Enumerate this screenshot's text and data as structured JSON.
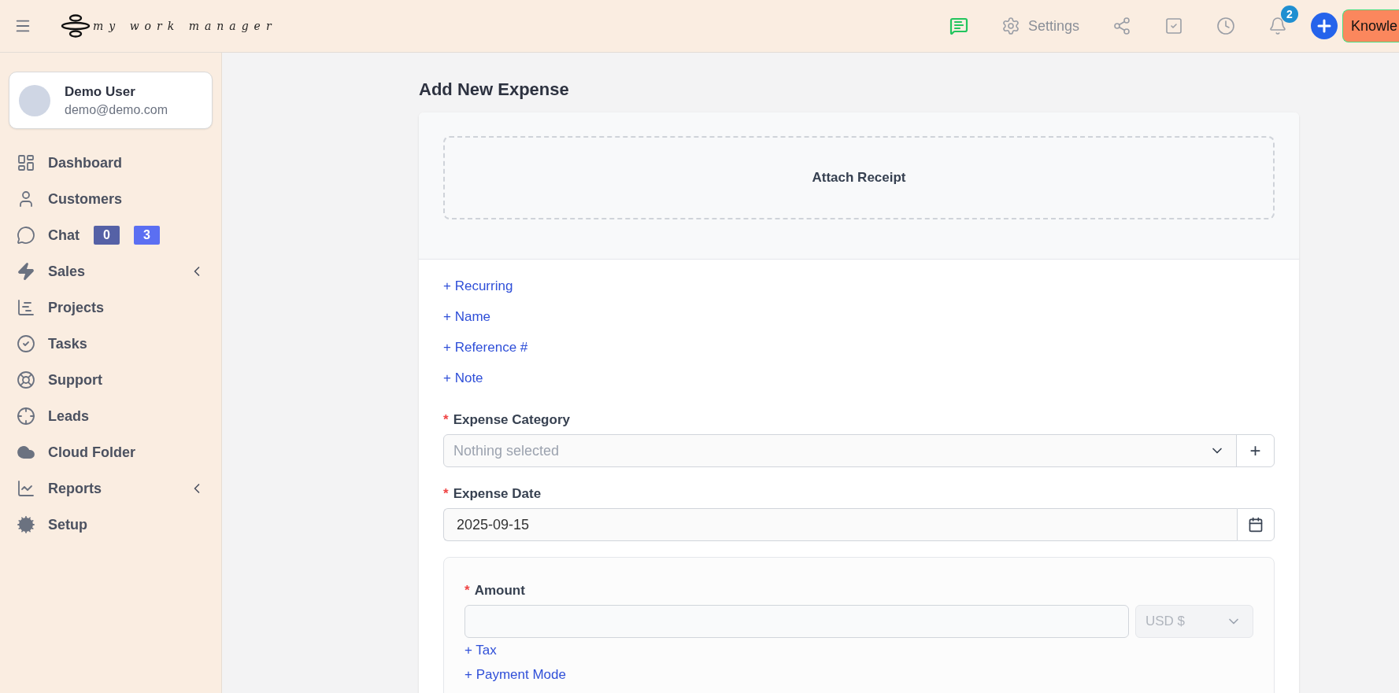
{
  "topbar": {
    "logo_text": "my work manager",
    "actions": [
      {
        "kind": "chat"
      },
      {
        "kind": "settings",
        "label": "Settings"
      },
      {
        "kind": "share"
      },
      {
        "kind": "tasks"
      },
      {
        "kind": "clock"
      },
      {
        "kind": "bell",
        "badge": "2"
      },
      {
        "kind": "add"
      }
    ],
    "knowledge_button": "Knowle"
  },
  "sidebar": {
    "user": {
      "name": "Demo User",
      "email": "demo@demo.com"
    },
    "items": [
      {
        "kind": "dashboard",
        "label": "Dashboard",
        "expandable": false
      },
      {
        "kind": "customers",
        "label": "Customers",
        "expandable": false
      },
      {
        "kind": "chat",
        "label": "Chat",
        "expandable": false,
        "badges": [
          {
            "text": "0",
            "color": "#5561a6"
          },
          {
            "text": "3",
            "color": "#5b6ff2"
          }
        ]
      },
      {
        "kind": "sales",
        "label": "Sales",
        "expandable": true
      },
      {
        "kind": "projects",
        "label": "Projects",
        "expandable": false
      },
      {
        "kind": "tasks",
        "label": "Tasks",
        "expandable": false
      },
      {
        "kind": "support",
        "label": "Support",
        "expandable": false
      },
      {
        "kind": "leads",
        "label": "Leads",
        "expandable": false
      },
      {
        "kind": "cloud",
        "label": "Cloud Folder",
        "expandable": false
      },
      {
        "kind": "reports",
        "label": "Reports",
        "expandable": true
      },
      {
        "kind": "setup",
        "label": "Setup",
        "expandable": false
      }
    ]
  },
  "form": {
    "title": "Add New Expense",
    "attach_label": "Attach Receipt",
    "links": [
      "+ Recurring",
      "+ Name",
      "+ Reference #",
      "+ Note"
    ],
    "category": {
      "label": "Expense Category",
      "required_mark": "*",
      "placeholder": "Nothing selected",
      "add_symbol": "+"
    },
    "date": {
      "label": "Expense Date",
      "required_mark": "*",
      "value": "2025-09-15"
    },
    "amount": {
      "label": "Amount",
      "required_mark": "*",
      "currency": "USD $",
      "links": [
        "+ Tax",
        "+ Payment Mode"
      ]
    }
  }
}
